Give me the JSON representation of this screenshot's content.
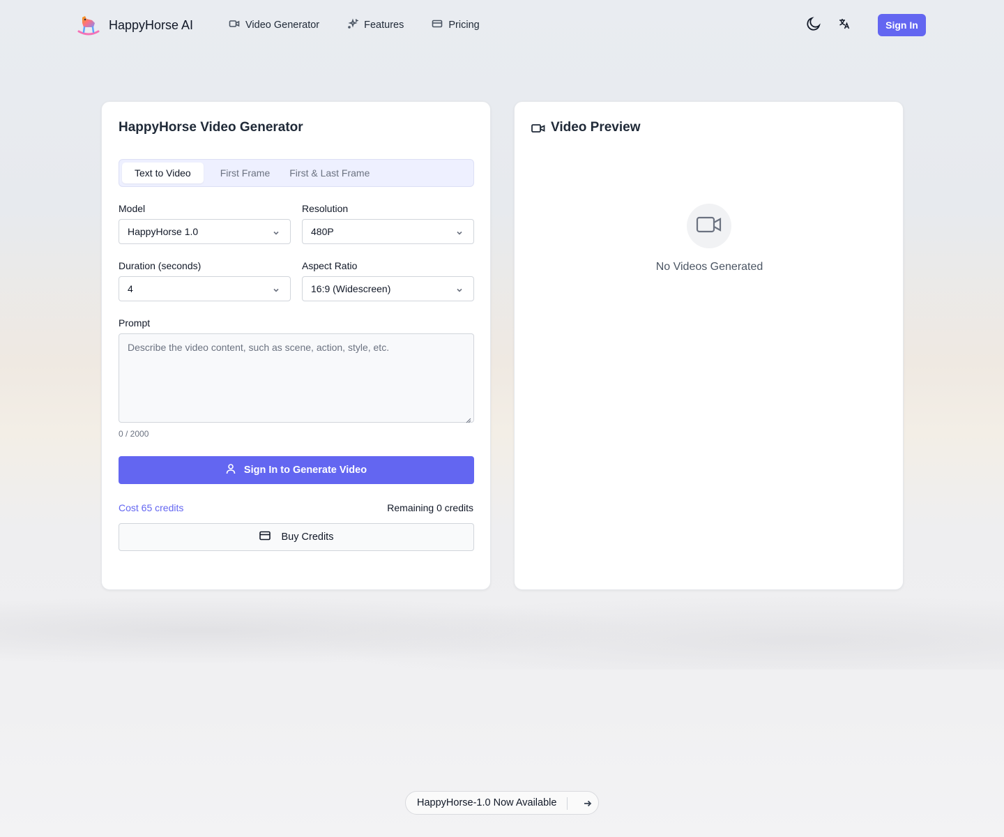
{
  "app": {
    "name": "HappyHorse AI"
  },
  "nav": {
    "items": [
      {
        "label": "Video Generator",
        "icon": "video-icon"
      },
      {
        "label": "Features",
        "icon": "sparkles-icon"
      },
      {
        "label": "Pricing",
        "icon": "credit-card-icon"
      }
    ]
  },
  "header": {
    "theme_icon": "moon-icon",
    "language_icon": "translate-icon",
    "sign_in_label": "Sign In"
  },
  "generator": {
    "title": "HappyHorse Video Generator",
    "tabs": [
      {
        "label": "Text to Video",
        "active": true
      },
      {
        "label": "First Frame",
        "active": false
      },
      {
        "label": "First & Last Frame",
        "active": false
      }
    ],
    "fields": {
      "model": {
        "label": "Model",
        "value": "HappyHorse 1.0"
      },
      "resolution": {
        "label": "Resolution",
        "value": "480P"
      },
      "duration": {
        "label": "Duration (seconds)",
        "value": "4"
      },
      "aspect_ratio": {
        "label": "Aspect Ratio",
        "value": "16:9 (Widescreen)"
      }
    },
    "prompt": {
      "label": "Prompt",
      "placeholder": "Describe the video content, such as scene, action, style, etc.",
      "value": "",
      "counter": "0 / 2000"
    },
    "generate_label": "Sign In to Generate Video",
    "cost": "Cost 65 credits",
    "remaining": "Remaining 0 credits",
    "buy_label": "Buy Credits"
  },
  "preview": {
    "title": "Video Preview",
    "empty_text": "No Videos Generated"
  },
  "banner": {
    "text": "HappyHorse-1.0 Now Available"
  },
  "colors": {
    "accent": "#6366f1",
    "tab_bg": "#eef0ff"
  }
}
